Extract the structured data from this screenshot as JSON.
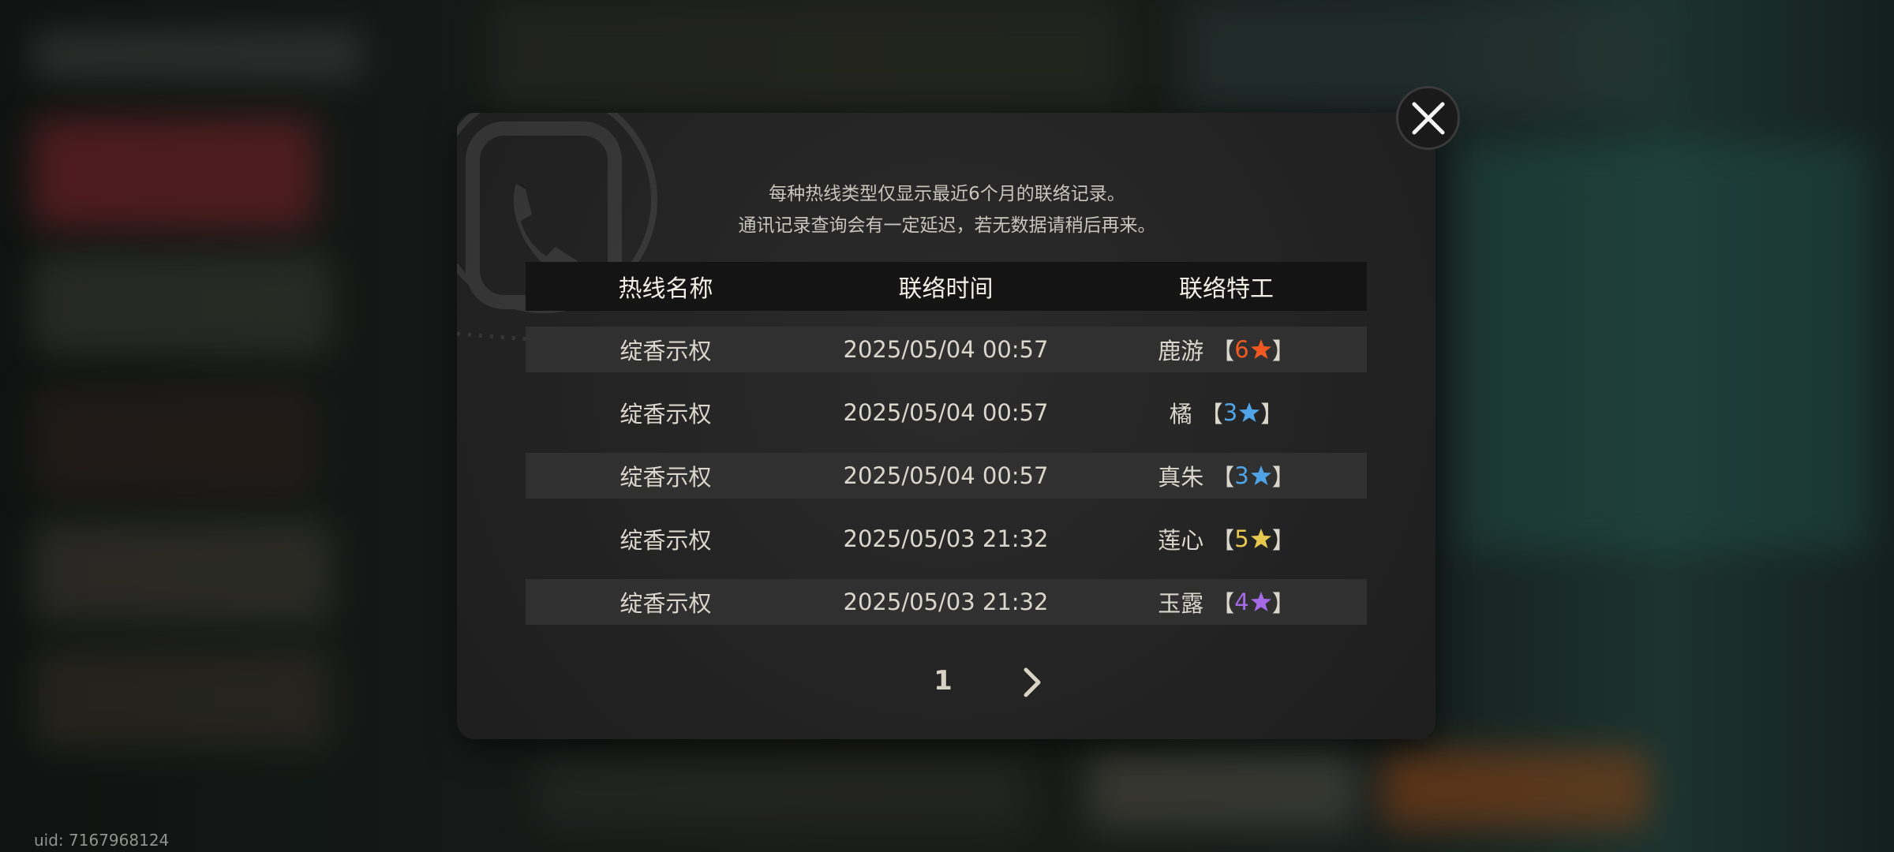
{
  "notice": {
    "line1": "每种热线类型仅显示最近6个月的联络记录。",
    "line2": "通讯记录查询会有一定延迟，若无数据请稍后再来。"
  },
  "table": {
    "headers": [
      "热线名称",
      "联络时间",
      "联络特工"
    ],
    "rows": [
      {
        "hotline": "绽香示权",
        "time": "2025/05/04 00:57",
        "agent": "鹿游",
        "rarity": "6",
        "rarity_color": "#f05a22"
      },
      {
        "hotline": "绽香示权",
        "time": "2025/05/04 00:57",
        "agent": "橘",
        "rarity": "3",
        "rarity_color": "#4fa3e6"
      },
      {
        "hotline": "绽香示权",
        "time": "2025/05/04 00:57",
        "agent": "真朱",
        "rarity": "3",
        "rarity_color": "#4fa3e6"
      },
      {
        "hotline": "绽香示权",
        "time": "2025/05/03 21:32",
        "agent": "莲心",
        "rarity": "5",
        "rarity_color": "#e7c84f"
      },
      {
        "hotline": "绽香示权",
        "time": "2025/05/03 21:32",
        "agent": "玉露",
        "rarity": "4",
        "rarity_color": "#a56ae6"
      }
    ]
  },
  "bracket_open": "【",
  "bracket_close": "】",
  "pager": {
    "current_page": "1"
  },
  "uid": "uid: 7167968124",
  "icons": {
    "close": "close-icon",
    "next": "chevron-right-icon",
    "star": "star-icon",
    "watermark": "phone-icon"
  }
}
